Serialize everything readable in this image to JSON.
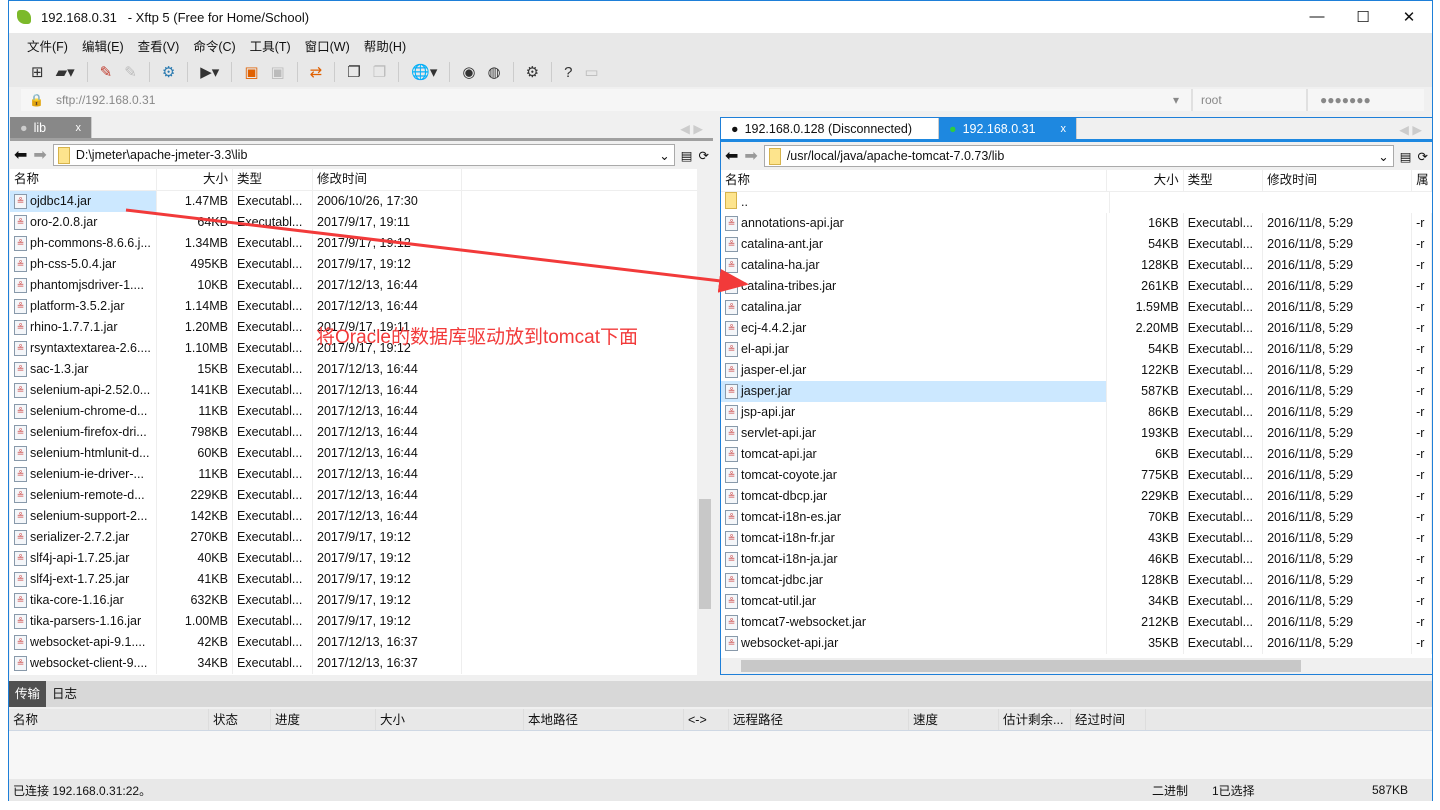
{
  "window": {
    "title": "192.168.0.31",
    "app": "   - Xftp 5 (Free for Home/School)"
  },
  "menu": [
    "文件(F)",
    "编辑(E)",
    "查看(V)",
    "命令(C)",
    "工具(T)",
    "窗口(W)",
    "帮助(H)"
  ],
  "address": {
    "url": "sftp://192.168.0.31",
    "user": "root",
    "password": "●●●●●●●"
  },
  "left": {
    "tab": "lib",
    "path": "D:\\jmeter\\apache-jmeter-3.3\\lib",
    "columns": [
      "名称",
      "大小",
      "类型",
      "修改时间"
    ],
    "rows": [
      [
        "ojdbc14.jar",
        "1.47MB",
        "Executabl...",
        "2006/10/26, 17:30"
      ],
      [
        "oro-2.0.8.jar",
        "64KB",
        "Executabl...",
        "2017/9/17, 19:11"
      ],
      [
        "ph-commons-8.6.6.j...",
        "1.34MB",
        "Executabl...",
        "2017/9/17, 19:12"
      ],
      [
        "ph-css-5.0.4.jar",
        "495KB",
        "Executabl...",
        "2017/9/17, 19:12"
      ],
      [
        "phantomjsdriver-1....",
        "10KB",
        "Executabl...",
        "2017/12/13, 16:44"
      ],
      [
        "platform-3.5.2.jar",
        "1.14MB",
        "Executabl...",
        "2017/12/13, 16:44"
      ],
      [
        "rhino-1.7.7.1.jar",
        "1.20MB",
        "Executabl...",
        "2017/9/17, 19:11"
      ],
      [
        "rsyntaxtextarea-2.6....",
        "1.10MB",
        "Executabl...",
        "2017/9/17, 19:12"
      ],
      [
        "sac-1.3.jar",
        "15KB",
        "Executabl...",
        "2017/12/13, 16:44"
      ],
      [
        "selenium-api-2.52.0...",
        "141KB",
        "Executabl...",
        "2017/12/13, 16:44"
      ],
      [
        "selenium-chrome-d...",
        "11KB",
        "Executabl...",
        "2017/12/13, 16:44"
      ],
      [
        "selenium-firefox-dri...",
        "798KB",
        "Executabl...",
        "2017/12/13, 16:44"
      ],
      [
        "selenium-htmlunit-d...",
        "60KB",
        "Executabl...",
        "2017/12/13, 16:44"
      ],
      [
        "selenium-ie-driver-...",
        "11KB",
        "Executabl...",
        "2017/12/13, 16:44"
      ],
      [
        "selenium-remote-d...",
        "229KB",
        "Executabl...",
        "2017/12/13, 16:44"
      ],
      [
        "selenium-support-2...",
        "142KB",
        "Executabl...",
        "2017/12/13, 16:44"
      ],
      [
        "serializer-2.7.2.jar",
        "270KB",
        "Executabl...",
        "2017/9/17, 19:12"
      ],
      [
        "slf4j-api-1.7.25.jar",
        "40KB",
        "Executabl...",
        "2017/9/17, 19:12"
      ],
      [
        "slf4j-ext-1.7.25.jar",
        "41KB",
        "Executabl...",
        "2017/9/17, 19:12"
      ],
      [
        "tika-core-1.16.jar",
        "632KB",
        "Executabl...",
        "2017/9/17, 19:12"
      ],
      [
        "tika-parsers-1.16.jar",
        "1.00MB",
        "Executabl...",
        "2017/9/17, 19:12"
      ],
      [
        "websocket-api-9.1....",
        "42KB",
        "Executabl...",
        "2017/12/13, 16:37"
      ],
      [
        "websocket-client-9....",
        "34KB",
        "Executabl...",
        "2017/12/13, 16:37"
      ]
    ]
  },
  "right": {
    "tabs": [
      "192.168.0.128 (Disconnected)",
      "192.168.0.31"
    ],
    "path": "/usr/local/java/apache-tomcat-7.0.73/lib",
    "columns": [
      "名称",
      "大小",
      "类型",
      "修改时间",
      "属"
    ],
    "parent": "..",
    "rows": [
      [
        "annotations-api.jar",
        "16KB",
        "Executabl...",
        "2016/11/8, 5:29",
        "-r"
      ],
      [
        "catalina-ant.jar",
        "54KB",
        "Executabl...",
        "2016/11/8, 5:29",
        "-r"
      ],
      [
        "catalina-ha.jar",
        "128KB",
        "Executabl...",
        "2016/11/8, 5:29",
        "-r"
      ],
      [
        "catalina-tribes.jar",
        "261KB",
        "Executabl...",
        "2016/11/8, 5:29",
        "-r"
      ],
      [
        "catalina.jar",
        "1.59MB",
        "Executabl...",
        "2016/11/8, 5:29",
        "-r"
      ],
      [
        "ecj-4.4.2.jar",
        "2.20MB",
        "Executabl...",
        "2016/11/8, 5:29",
        "-r"
      ],
      [
        "el-api.jar",
        "54KB",
        "Executabl...",
        "2016/11/8, 5:29",
        "-r"
      ],
      [
        "jasper-el.jar",
        "122KB",
        "Executabl...",
        "2016/11/8, 5:29",
        "-r"
      ],
      [
        "jasper.jar",
        "587KB",
        "Executabl...",
        "2016/11/8, 5:29",
        "-r"
      ],
      [
        "jsp-api.jar",
        "86KB",
        "Executabl...",
        "2016/11/8, 5:29",
        "-r"
      ],
      [
        "servlet-api.jar",
        "193KB",
        "Executabl...",
        "2016/11/8, 5:29",
        "-r"
      ],
      [
        "tomcat-api.jar",
        "6KB",
        "Executabl...",
        "2016/11/8, 5:29",
        "-r"
      ],
      [
        "tomcat-coyote.jar",
        "775KB",
        "Executabl...",
        "2016/11/8, 5:29",
        "-r"
      ],
      [
        "tomcat-dbcp.jar",
        "229KB",
        "Executabl...",
        "2016/11/8, 5:29",
        "-r"
      ],
      [
        "tomcat-i18n-es.jar",
        "70KB",
        "Executabl...",
        "2016/11/8, 5:29",
        "-r"
      ],
      [
        "tomcat-i18n-fr.jar",
        "43KB",
        "Executabl...",
        "2016/11/8, 5:29",
        "-r"
      ],
      [
        "tomcat-i18n-ja.jar",
        "46KB",
        "Executabl...",
        "2016/11/8, 5:29",
        "-r"
      ],
      [
        "tomcat-jdbc.jar",
        "128KB",
        "Executabl...",
        "2016/11/8, 5:29",
        "-r"
      ],
      [
        "tomcat-util.jar",
        "34KB",
        "Executabl...",
        "2016/11/8, 5:29",
        "-r"
      ],
      [
        "tomcat7-websocket.jar",
        "212KB",
        "Executabl...",
        "2016/11/8, 5:29",
        "-r"
      ],
      [
        "websocket-api.jar",
        "35KB",
        "Executabl...",
        "2016/11/8, 5:29",
        "-r"
      ]
    ]
  },
  "transfer": {
    "tabs": [
      "传输",
      "日志"
    ],
    "columns": [
      "名称",
      "状态",
      "进度",
      "大小",
      "本地路径",
      "<->",
      "远程路径",
      "速度",
      "估计剩余...",
      "经过时间"
    ]
  },
  "status": {
    "left": "已连接 192.168.0.31:22。",
    "mode": "二进制",
    "selected": "1已选择",
    "size": "587KB"
  },
  "annotation": "将Oracle的数据库驱动放到tomcat下面"
}
